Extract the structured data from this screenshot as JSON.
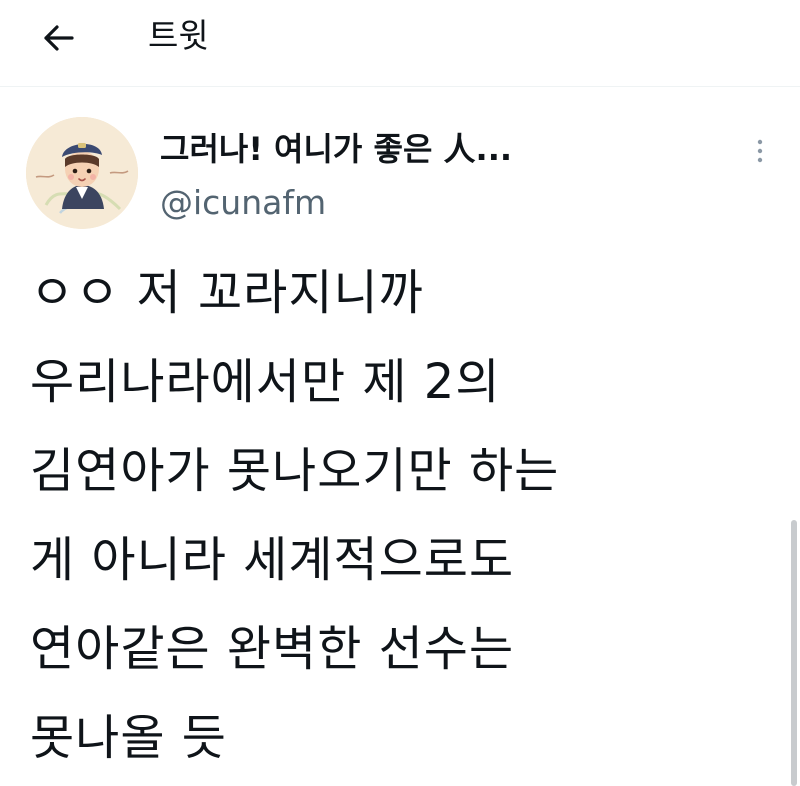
{
  "header": {
    "title": "트윗",
    "back_icon": "arrow-left-icon"
  },
  "tweet": {
    "avatar_icon": "cartoon-avatar-icon",
    "display_name": "그러나! 여니가 좋은 人...",
    "handle": "@icunafm",
    "more_icon": "more-vertical-icon",
    "text": "ㅇㅇ 저 꼬라지니까\n우리나라에서만 제 2의\n김연아가 못나오기만 하는\n게 아니라 세계적으로도\n연아같은 완벽한 선수는\n못나올 듯"
  },
  "colors": {
    "text_primary": "#0f1419",
    "text_secondary": "#536471",
    "border": "#eff3f4"
  }
}
